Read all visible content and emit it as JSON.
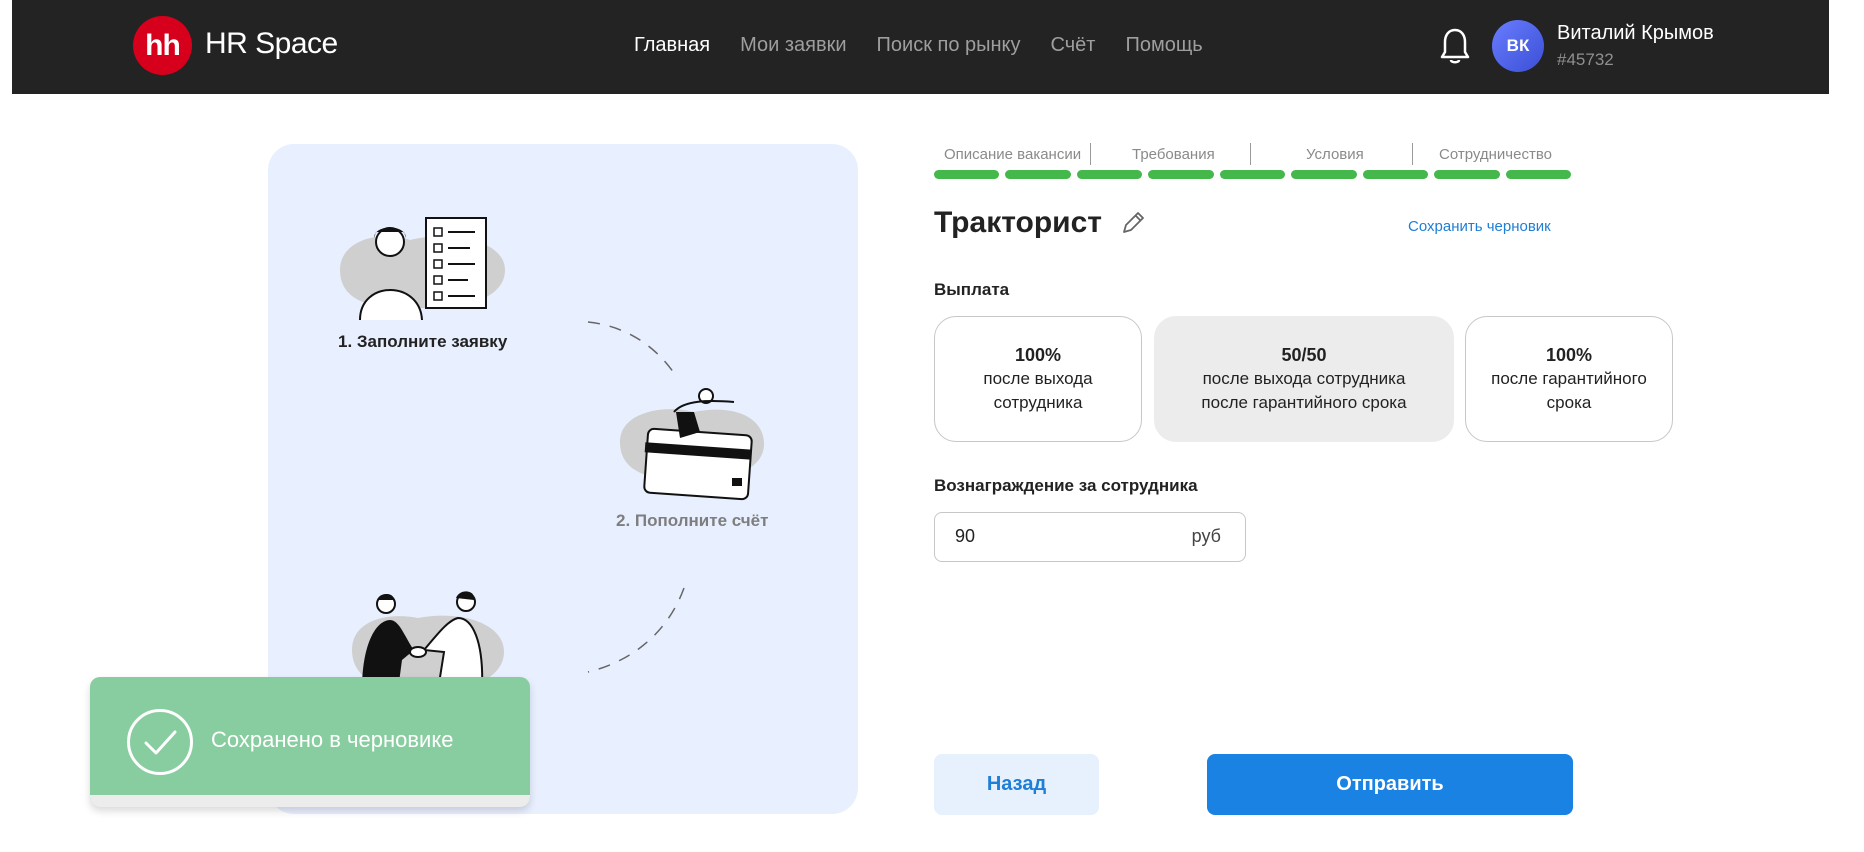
{
  "header": {
    "logo_text": "hh",
    "brand": "HR Space",
    "nav": [
      "Главная",
      "Мои заявки",
      "Поиск по рынку",
      "Счёт",
      "Помощь"
    ],
    "avatar_initials": "ВК",
    "user_name": "Виталий Крымов",
    "user_id": "#45732"
  },
  "steps": {
    "step1": "1. Заполните заявку",
    "step2": "2. Пополните счёт"
  },
  "toast": {
    "text": "Сохранено в черновике"
  },
  "progress": {
    "labels": [
      "Описание вакансии",
      "Требования",
      "Условия",
      "Сотрудничество"
    ],
    "completed_segments": 9,
    "total_segments": 9
  },
  "form": {
    "title": "Тракторист",
    "save_draft": "Сохранить черновик",
    "payout_label": "Выплата",
    "payout_options": [
      {
        "headline": "100%",
        "line1": "после выхода",
        "line2": "сотрудника"
      },
      {
        "headline": "50/50",
        "line1": "после выхода сотрудника",
        "line2": "после гарантийного срока"
      },
      {
        "headline": "100%",
        "line1": "после гарантийного",
        "line2": "срока"
      }
    ],
    "selected_payout": 1,
    "reward_label": "Вознаграждение за сотрудника",
    "reward_value": "90",
    "reward_unit": "руб",
    "back_button": "Назад",
    "submit_button": "Отправить"
  },
  "colors": {
    "header_bg": "#232323",
    "logo_red": "#d6001c",
    "panel_bg": "#e8efff",
    "progress_green": "#44b84b",
    "toast_green": "#88cd9f",
    "accent_blue": "#1a82e2"
  }
}
